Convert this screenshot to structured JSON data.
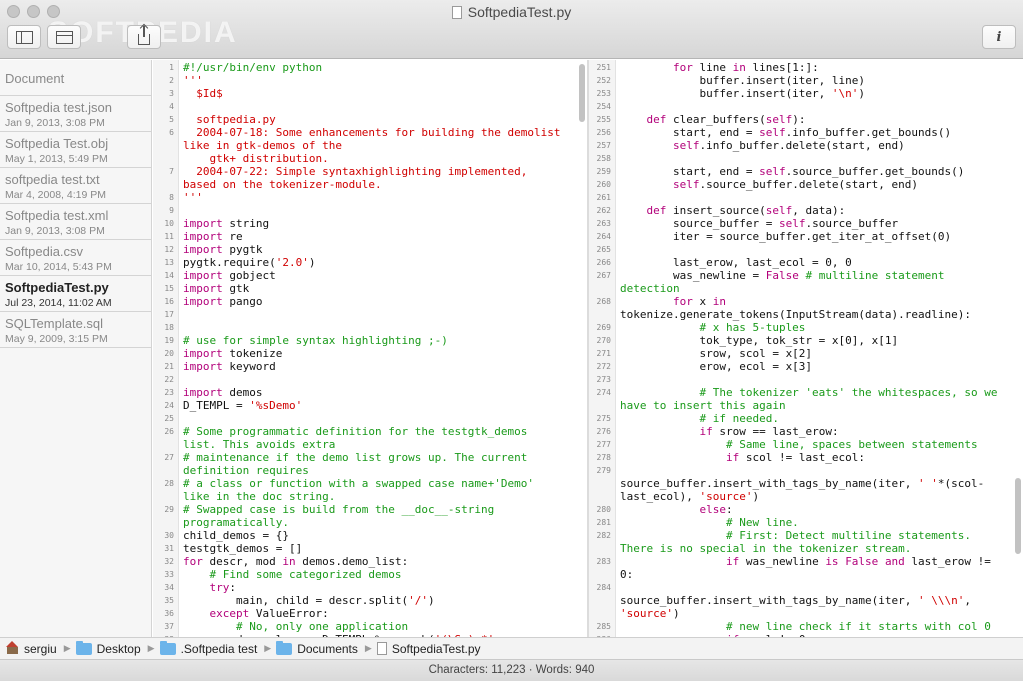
{
  "window": {
    "title": "SoftpediaTest.py",
    "watermark": "SOFTPEDIA"
  },
  "toolbar": {
    "sidebar_icon": "sidebar-icon",
    "toolbar_icon": "toolbar-icon",
    "share_icon": "share-icon",
    "info_icon": "info-icon",
    "info_label": "i"
  },
  "sidebar": {
    "header": "Document",
    "items": [
      {
        "name": "Softpedia test.json",
        "date": "Jan 9, 2013, 3:08 PM",
        "selected": false
      },
      {
        "name": "Softpedia Test.obj",
        "date": "May 1, 2013, 5:49 PM",
        "selected": false
      },
      {
        "name": "softpedia test.txt",
        "date": "Mar 4, 2008, 4:19 PM",
        "selected": false
      },
      {
        "name": "Softpedia test.xml",
        "date": "Jan 9, 2013, 3:08 PM",
        "selected": false
      },
      {
        "name": "Softpedia.csv",
        "date": "Mar 10, 2014, 5:43 PM",
        "selected": false
      },
      {
        "name": "SoftpediaTest.py",
        "date": "Jul 23, 2014, 11:02 AM",
        "selected": true
      },
      {
        "name": "SQLTemplate.sql",
        "date": "May 9, 2009, 3:15 PM",
        "selected": false
      }
    ]
  },
  "editor_left": {
    "rows": [
      {
        "n": "1",
        "t": "#!/usr/bin/env python"
      },
      {
        "n": "2",
        "t": "'''",
        "c": "s"
      },
      {
        "n": "3",
        "t": "  $Id$",
        "c": "s"
      },
      {
        "n": "4",
        "t": ""
      },
      {
        "n": "5",
        "t": "  softpedia.py",
        "c": "s"
      },
      {
        "n": "6",
        "t": "  2004-07-18: Some enhancements for building the demolist",
        "c": "s"
      },
      {
        "n": "",
        "t": "like in gtk-demos of the",
        "c": "s"
      },
      {
        "n": "",
        "t": "    gtk+ distribution.",
        "c": "s"
      },
      {
        "n": "7",
        "t": "  2004-07-22: Simple syntaxhighlighting implemented,",
        "c": "s"
      },
      {
        "n": "",
        "t": "based on the tokenizer-module.",
        "c": "s"
      },
      {
        "n": "8",
        "t": "'''",
        "c": "s"
      },
      {
        "n": "9",
        "t": ""
      },
      {
        "n": "10",
        "t": "import string",
        "c": "imp"
      },
      {
        "n": "11",
        "t": "import re",
        "c": "imp"
      },
      {
        "n": "12",
        "t": "import pygtk",
        "c": "imp"
      },
      {
        "n": "13",
        "t": "pygtk.require('2.0')"
      },
      {
        "n": "14",
        "t": "import gobject",
        "c": "imp"
      },
      {
        "n": "15",
        "t": "import gtk",
        "c": "imp"
      },
      {
        "n": "16",
        "t": "import pango",
        "c": "imp"
      },
      {
        "n": "17",
        "t": ""
      },
      {
        "n": "18",
        "t": ""
      },
      {
        "n": "19",
        "t": "# use for simple syntax highlighting ;-)",
        "c": "c"
      },
      {
        "n": "20",
        "t": "import tokenize",
        "c": "imp"
      },
      {
        "n": "21",
        "t": "import keyword",
        "c": "imp"
      },
      {
        "n": "22",
        "t": ""
      },
      {
        "n": "23",
        "t": "import demos",
        "c": "imp"
      },
      {
        "n": "24",
        "t": "D_TEMPL = '%sDemo'"
      },
      {
        "n": "25",
        "t": ""
      },
      {
        "n": "26",
        "t": "# Some programmatic definition for the testgtk_demos",
        "c": "c"
      },
      {
        "n": "",
        "t": "list. This avoids extra",
        "c": "c"
      },
      {
        "n": "27",
        "t": "# maintenance if the demo list grows up. The current",
        "c": "c"
      },
      {
        "n": "",
        "t": "definition requires",
        "c": "c"
      },
      {
        "n": "28",
        "t": "# a class or function with a swapped case name+'Demo'",
        "c": "c"
      },
      {
        "n": "",
        "t": "like in the doc string.",
        "c": "c"
      },
      {
        "n": "29",
        "t": "# Swapped case is build from the __doc__-string",
        "c": "c"
      },
      {
        "n": "",
        "t": "programatically.",
        "c": "c"
      },
      {
        "n": "30",
        "t": "child_demos = {}"
      },
      {
        "n": "31",
        "t": "testgtk_demos = []"
      },
      {
        "n": "32",
        "t": "for descr, mod in demos.demo_list:"
      },
      {
        "n": "33",
        "t": "    # Find some categorized demos",
        "c": "c"
      },
      {
        "n": "34",
        "t": "    try:"
      },
      {
        "n": "35",
        "t": "        main, child = descr.split('/')"
      },
      {
        "n": "36",
        "t": "    except ValueError:"
      },
      {
        "n": "37",
        "t": "        # No, only one application",
        "c": "c"
      },
      {
        "n": "38",
        "t": "        demo_class = D_TEMPL % re.sub('(\\S+) *',"
      }
    ]
  },
  "editor_right": {
    "rows": [
      {
        "n": "251",
        "t": "        for line in lines[1:]:"
      },
      {
        "n": "252",
        "t": "            buffer.insert(iter, line)"
      },
      {
        "n": "253",
        "t": "            buffer.insert(iter, '\\n')"
      },
      {
        "n": "254",
        "t": ""
      },
      {
        "n": "255",
        "t": "    def clear_buffers(self):"
      },
      {
        "n": "256",
        "t": "        start, end = self.info_buffer.get_bounds()"
      },
      {
        "n": "257",
        "t": "        self.info_buffer.delete(start, end)"
      },
      {
        "n": "258",
        "t": ""
      },
      {
        "n": "259",
        "t": "        start, end = self.source_buffer.get_bounds()"
      },
      {
        "n": "260",
        "t": "        self.source_buffer.delete(start, end)"
      },
      {
        "n": "261",
        "t": ""
      },
      {
        "n": "262",
        "t": "    def insert_source(self, data):"
      },
      {
        "n": "263",
        "t": "        source_buffer = self.source_buffer"
      },
      {
        "n": "264",
        "t": "        iter = source_buffer.get_iter_at_offset(0)"
      },
      {
        "n": "265",
        "t": ""
      },
      {
        "n": "266",
        "t": "        last_erow, last_ecol = 0, 0"
      },
      {
        "n": "267",
        "t": "        was_newline = False # multiline statement"
      },
      {
        "n": "",
        "t": "detection",
        "c": "c"
      },
      {
        "n": "268",
        "t": "        for x in"
      },
      {
        "n": "",
        "t": "tokenize.generate_tokens(InputStream(data).readline):"
      },
      {
        "n": "269",
        "t": "            # x has 5-tuples",
        "c": "c"
      },
      {
        "n": "270",
        "t": "            tok_type, tok_str = x[0], x[1]"
      },
      {
        "n": "271",
        "t": "            srow, scol = x[2]"
      },
      {
        "n": "272",
        "t": "            erow, ecol = x[3]"
      },
      {
        "n": "273",
        "t": ""
      },
      {
        "n": "274",
        "t": "            # The tokenizer 'eats' the whitespaces, so we",
        "c": "c"
      },
      {
        "n": "",
        "t": "have to insert this again",
        "c": "c"
      },
      {
        "n": "275",
        "t": "            # if needed.",
        "c": "c"
      },
      {
        "n": "276",
        "t": "            if srow == last_erow:"
      },
      {
        "n": "277",
        "t": "                # Same line, spaces between statements",
        "c": "c"
      },
      {
        "n": "278",
        "t": "                if scol != last_ecol:"
      },
      {
        "n": "279",
        "t": ""
      },
      {
        "n": "",
        "t": "source_buffer.insert_with_tags_by_name(iter, ' '*(scol-"
      },
      {
        "n": "",
        "t": "last_ecol), 'source')"
      },
      {
        "n": "280",
        "t": "            else:"
      },
      {
        "n": "281",
        "t": "                # New line.",
        "c": "c"
      },
      {
        "n": "282",
        "t": "                # First: Detect multiline statements.",
        "c": "c"
      },
      {
        "n": "",
        "t": "There is no special in the tokenizer stream.",
        "c": "c"
      },
      {
        "n": "283",
        "t": "                if was_newline is False and last_erow !="
      },
      {
        "n": "",
        "t": "0:"
      },
      {
        "n": "284",
        "t": ""
      },
      {
        "n": "",
        "t": "source_buffer.insert_with_tags_by_name(iter, ' \\\\\\n',"
      },
      {
        "n": "",
        "t": "'source')"
      },
      {
        "n": "285",
        "t": "                # new line check if it starts with col 0",
        "c": "c"
      },
      {
        "n": "286",
        "t": "                if scol != 0:"
      }
    ]
  },
  "pathbar": {
    "items": [
      {
        "label": "sergiu",
        "icon": "home-icon"
      },
      {
        "label": "Desktop",
        "icon": "folder-icon"
      },
      {
        "label": ".Softpedia test",
        "icon": "folder-icon"
      },
      {
        "label": "Documents",
        "icon": "folder-icon"
      },
      {
        "label": "SoftpediaTest.py",
        "icon": "file-icon"
      }
    ]
  },
  "status": {
    "text": "Characters: 11,223  ·  Words: 940"
  },
  "colors": {
    "keyword": "#b2007a",
    "string": "#d00000",
    "comment": "#1a9a1a",
    "selection_sidebar": "#e4e4e4"
  }
}
